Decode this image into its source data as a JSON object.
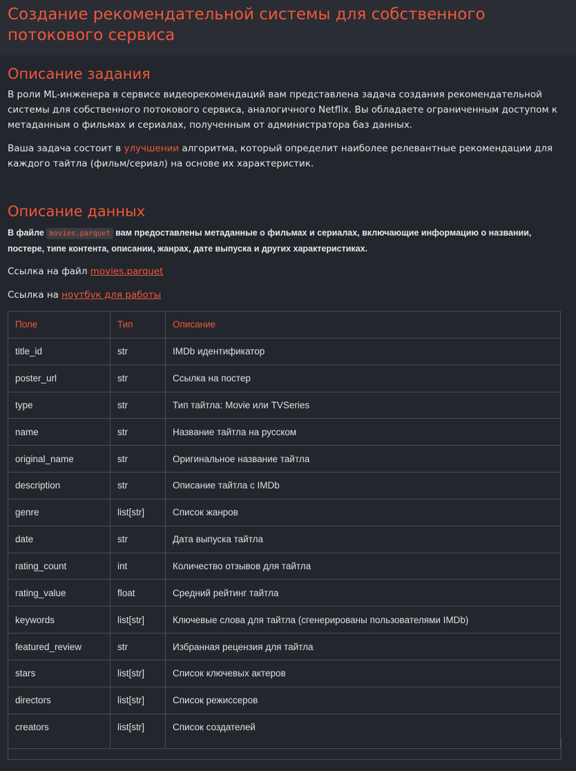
{
  "title": "Создание рекомендательной системы для собственного потокового сервиса",
  "task_section": {
    "heading": "Описание задания",
    "paragraph1": "В роли ML-инженера в сервисе видеорекомендаций вам представлена задача создания рекомендательной системы для собственного потокового сервиса, аналогичного Netflix. Вы обладаете ограниченным доступом к метаданным о фильмах и сериалах, полученным от администратора баз данных.",
    "paragraph2_before": "Ваша задача состоит в ",
    "paragraph2_highlight": "улучшении",
    "paragraph2_after": " алгоритма, который определит наиболее релевантные рекомендации для каждого тайтла (фильм/сериал) на основе их характеристик."
  },
  "data_section": {
    "heading": "Описание данных",
    "intro_before": "В файле ",
    "intro_code": "movies.parquet",
    "intro_after": " вам предоставлены метаданные о фильмах и сериалах, включающие информацию о названии, постере, типе контента, описании, жанрах, дате выпуска и других характеристиках.",
    "file_link_label": "Ссылка на файл ",
    "file_link_text": "movies.parquet",
    "notebook_link_label": "Ссылка на ",
    "notebook_link_text": "ноутбук для работы"
  },
  "table": {
    "headers": [
      "Поле",
      "Тип",
      "Описание"
    ],
    "rows": [
      [
        "title_id",
        "str",
        "IMDb идентификатор"
      ],
      [
        "poster_url",
        "str",
        "Ссылка на постер"
      ],
      [
        "type",
        "str",
        "Тип тайтла: Movie или TVSeries"
      ],
      [
        "name",
        "str",
        "Название тайтла на русском"
      ],
      [
        "original_name",
        "str",
        "Оригинальное название тайтла"
      ],
      [
        "description",
        "str",
        "Описание тайтла с IMDb"
      ],
      [
        "genre",
        "list[str]",
        "Список жанров"
      ],
      [
        "date",
        "str",
        "Дата выпуска тайтла"
      ],
      [
        "rating_count",
        "int",
        "Количество отзывов для тайтла"
      ],
      [
        "rating_value",
        "float",
        "Средний рейтинг тайтла"
      ],
      [
        "keywords",
        "list[str]",
        "Ключевые слова для тайтла (сгенерированы пользователями IMDb)"
      ],
      [
        "featured_review",
        "str",
        "Избранная рецензия для тайтла"
      ],
      [
        "stars",
        "list[str]",
        "Список ключевых актеров"
      ],
      [
        "directors",
        "list[str]",
        "Список режиссеров"
      ],
      [
        "creators",
        "list[str]",
        "Список создателей"
      ]
    ]
  }
}
